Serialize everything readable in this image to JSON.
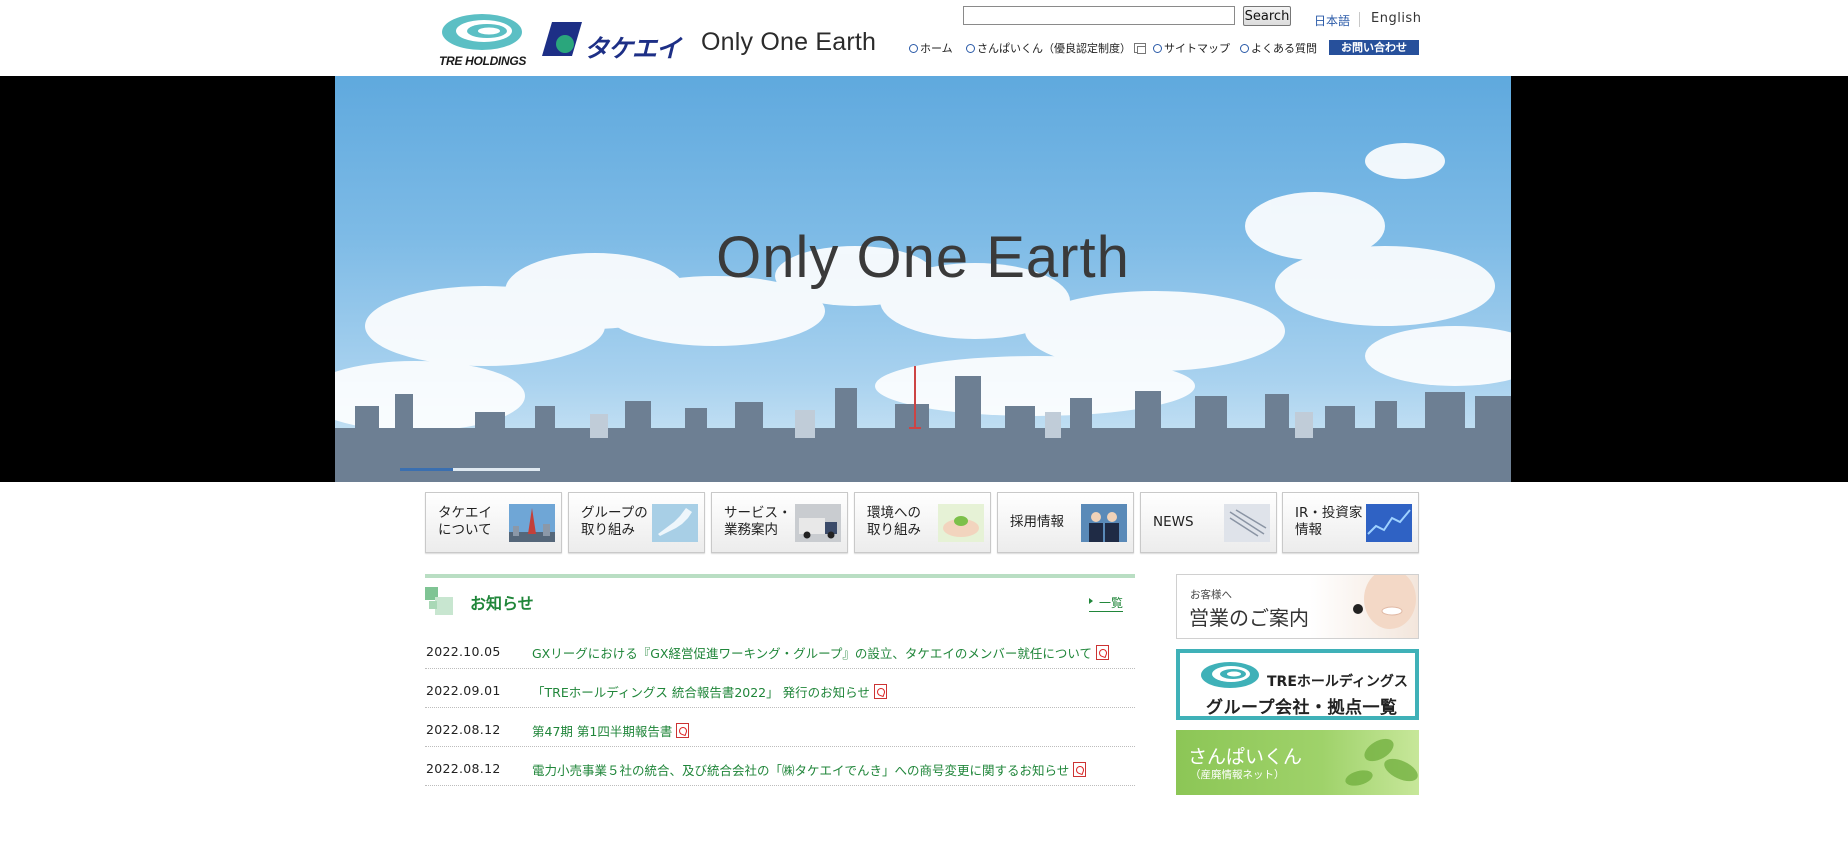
{
  "header": {
    "tre_logo_text": "TRE HOLDINGS",
    "takeei_logo_text": "タケエイ",
    "tagline": "Only One Earth",
    "search": {
      "value": "",
      "placeholder": "",
      "button_label": "Search"
    },
    "languages": {
      "japanese": "日本語",
      "english": "English"
    },
    "nav": [
      {
        "label": "ホーム"
      },
      {
        "label": "さんぱいくん（優良認定制度）"
      },
      {
        "label": "サイトマップ"
      },
      {
        "label": "よくある質問"
      }
    ],
    "contact_label": "お問い合わせ"
  },
  "hero": {
    "title": "Only One Earth",
    "slide_progress": 0.38
  },
  "tiles": [
    {
      "label": "タケエイ\nについて",
      "thumb": "tokyo-tower-image"
    },
    {
      "label": "グループの\n取り組み",
      "thumb": "japan-map-image"
    },
    {
      "label": "サービス・\n業務案内",
      "thumb": "truck-image"
    },
    {
      "label": "環境への\n取り組み",
      "thumb": "hands-image"
    },
    {
      "label": "採用情報",
      "thumb": "people-image"
    },
    {
      "label": "NEWS",
      "thumb": "newspaper-image"
    },
    {
      "label": "IR・投資家\n情報",
      "thumb": "chart-image"
    }
  ],
  "news": {
    "heading": "お知らせ",
    "more_label": "一覧",
    "items": [
      {
        "date": "2022.10.05",
        "title": "GXリーグにおける『GX経営促進ワーキング・グループ』の設立、タケエイのメンバー就任について"
      },
      {
        "date": "2022.09.01",
        "title": "「TREホールディングス 統合報告書2022」 発行のお知らせ"
      },
      {
        "date": "2022.08.12",
        "title": "第47期 第1四半期報告書"
      },
      {
        "date": "2022.08.12",
        "title": "電力小売事業５社の統合、及び統合会社の「㈱タケエイでんき」への商号変更に関するお知らせ"
      }
    ]
  },
  "banners": {
    "sales": {
      "small": "お客様へ",
      "big": "営業のご案内"
    },
    "group": {
      "line1": "TREホールディングス",
      "line2": "グループ会社・拠点一覧"
    },
    "sanpai": {
      "line1": "さんぱいくん",
      "line2": "（産廃情報ネット）"
    }
  },
  "colors": {
    "brand_navy": "#1d2f86",
    "brand_teal": "#3fb1b8",
    "link_green": "#20863a",
    "nav_blue": "#27509b"
  }
}
